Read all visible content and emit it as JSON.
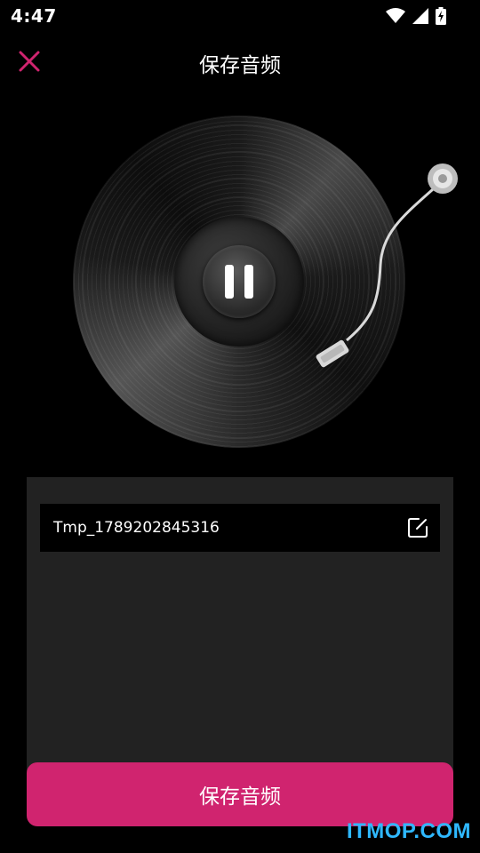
{
  "status_bar": {
    "time": "4:47",
    "icons": [
      "wifi-icon",
      "signal-icon",
      "battery-charging-icon"
    ]
  },
  "header": {
    "title": "保存音频",
    "close_icon": "close-icon",
    "accent_color": "#d0246f"
  },
  "player": {
    "state_icon": "pause-icon"
  },
  "file": {
    "name": "Tmp_1789202845316",
    "edit_icon": "edit-icon"
  },
  "save_button": {
    "label": "保存音频",
    "color": "#d0246f"
  },
  "watermark": {
    "text": "ITMOP.COM",
    "color": "#2fb8ff"
  }
}
